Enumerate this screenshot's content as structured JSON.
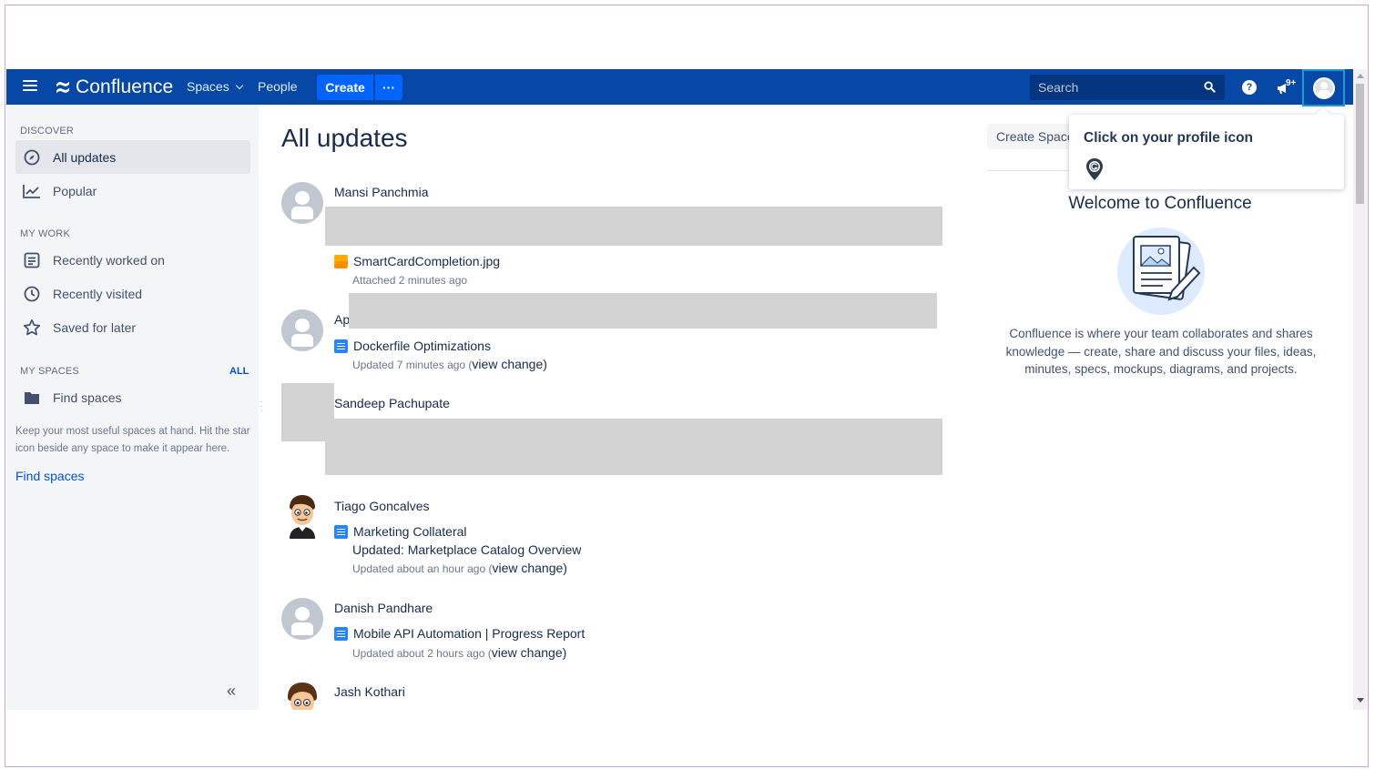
{
  "nav": {
    "logo_text": "Confluence",
    "spaces_label": "Spaces",
    "people_label": "People",
    "create_label": "Create",
    "more_label": "···",
    "search_placeholder": "Search",
    "help_label": "?",
    "notification_badge": "9+"
  },
  "sidebar": {
    "discover_title": "DISCOVER",
    "discover_items": [
      {
        "label": "All updates",
        "icon": "compass-icon",
        "active": true
      },
      {
        "label": "Popular",
        "icon": "trending-chart-icon"
      }
    ],
    "mywork_title": "MY WORK",
    "mywork_items": [
      {
        "label": "Recently worked on",
        "icon": "document-list-icon"
      },
      {
        "label": "Recently visited",
        "icon": "clock-icon"
      },
      {
        "label": "Saved for later",
        "icon": "star-icon"
      }
    ],
    "myspaces_title": "MY SPACES",
    "all_link": "ALL",
    "find_spaces_item": "Find spaces",
    "note": "Keep your most useful spaces at hand. Hit the star icon beside any space to make it appear here.",
    "find_spaces_link": "Find spaces",
    "collapse_label": "«"
  },
  "main": {
    "title": "All updates",
    "updates": [
      {
        "user": "Mansi Panchmia",
        "item": "SmartCardCompletion.jpg",
        "meta": "Attached 2 minutes ago"
      },
      {
        "user": "Ap",
        "item": "Dockerfile Optimizations",
        "meta": "Updated 7 minutes ago (",
        "view_change": "view change)"
      },
      {
        "user": "Sandeep Pachupate"
      },
      {
        "user": "Tiago Goncalves",
        "item": "Marketing Collateral",
        "subline": "Updated: Marketplace Catalog Overview",
        "meta": "Updated about an hour ago (",
        "view_change": "view change)"
      },
      {
        "user": "Danish Pandhare",
        "item": "Mobile API Automation | Progress Report",
        "meta": "Updated about 2 hours ago (",
        "view_change": "view change)"
      },
      {
        "user": "Jash Kothari"
      }
    ]
  },
  "right_panel": {
    "create_space_label": "Create Space",
    "welcome_title": "Welcome to Confluence",
    "welcome_text": "Confluence is where your team collaborates and shares knowledge — create, share and discuss your files, ideas, minutes, specs, mockups, diagrams, and projects."
  },
  "tooltip": {
    "text": "Click on your profile icon"
  },
  "colors": {
    "nav_bg": "#0747a6",
    "create_btn": "#0065ff",
    "link": "#0052cc",
    "sidebar_bg": "#f4f5f7",
    "redaction": "#d3d3d3"
  }
}
